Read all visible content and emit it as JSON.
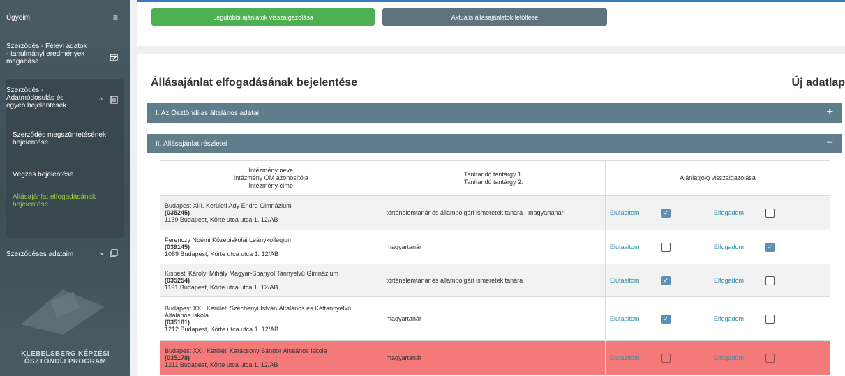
{
  "sidebar": {
    "ugyeim": "Ügyeim",
    "felevi": "Szerződés - Félévi adatok - tanulmányi eredmények megadása",
    "adatmod": "Szerződés - Adatmódosulás és egyéb bejelentések",
    "subitems": [
      "Szerződés megszüntetésének bejelentése",
      "Végzés bejelentése",
      "Állásajánlat elfogadásának bejelentése"
    ],
    "szerzodeses": "Szerződéses adataim",
    "program": "KLEBELSBERG KÉPZÉSI ÖSZTÖNDÍJ PROGRAM"
  },
  "topbar": {
    "btn_vissza": "Legutóbbi ajánlatok visszaigazolása",
    "btn_letoltes": "Aktuális állásajánlatok letöltése"
  },
  "main": {
    "title": "Állásajánlat elfogadásának bejelentése",
    "new_sheet": "Új adatlap",
    "section1": "I. Az Ösztöndíjas általános adatai",
    "section2": "II. Állásajánlat részletei",
    "toggle_plus": "+",
    "toggle_minus": "−"
  },
  "table": {
    "headers": {
      "col1_l1": "Intézmény neve",
      "col1_l2": "Intézmény OM azonosítója",
      "col1_l3": "Intézmény címe",
      "col2_l1": "Tanítandó tantárgy 1.",
      "col2_l2": "Tanítandó tantárgy 2.",
      "col3": "Ajánlat(ok) visszaigazolása"
    },
    "reject_label": "Elutasítom",
    "accept_label": "Elfogadom",
    "rows": [
      {
        "name": "Budapest XIII. Kerületi Ady Endre Gimnázium",
        "om": "035245",
        "address": "1139 Budapest, Körte utca utca 1. 12/AB",
        "subject": "történelemtanár és állampolgári ismeretek tanára - magyartanár",
        "reject": true,
        "accept": false
      },
      {
        "name": "Ferenczy Noémi Középiskolai Leánykollégium",
        "om": "039145",
        "address": "1089 Budapest, Körte utca utca 1. 12/AB",
        "subject": "magyartanár",
        "reject": false,
        "accept": true
      },
      {
        "name": "Kispesti Károlyi Mihály Magyar-Spanyol Tannyelvű Gimnázium",
        "om": "035254",
        "address": "1191 Budapest, Körte utca utca 1. 12/AB",
        "subject": "történelemtanár és állampolgári ismeretek tanára",
        "reject": true,
        "accept": false
      },
      {
        "name": "Budapest XXI. Kerületi Széchenyi István Általános és Kéttannyelvű Általános Iskola",
        "om": "035181",
        "address": "1212 Budapest, Körte utca utca 1. 12/AB",
        "subject": "magyartanár",
        "reject": true,
        "accept": false
      },
      {
        "name": "Budapest XXI. Kerületi Karácsony Sándor Általános Iskola",
        "om": "035178",
        "address": "1211 Budapest, Körte utca utca 1. 12/AB",
        "subject": "magyartanár",
        "reject": false,
        "accept": false
      }
    ]
  }
}
